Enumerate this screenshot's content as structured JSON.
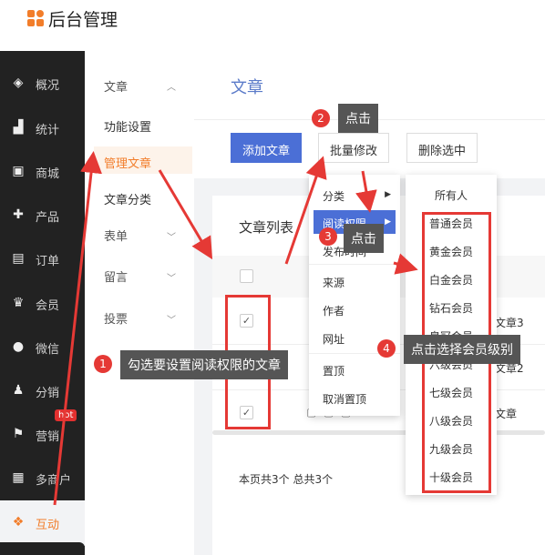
{
  "app": {
    "title": "后台管理",
    "brand_color": "#f27d2a"
  },
  "sidebar": {
    "items": [
      {
        "label": "概况",
        "icon": "layers-icon"
      },
      {
        "label": "统计",
        "icon": "chart-icon"
      },
      {
        "label": "商城",
        "icon": "shop-icon"
      },
      {
        "label": "产品",
        "icon": "grid-icon"
      },
      {
        "label": "订单",
        "icon": "clipboard-icon"
      },
      {
        "label": "会员",
        "icon": "crown-icon"
      },
      {
        "label": "微信",
        "icon": "chat-icon"
      },
      {
        "label": "分销",
        "icon": "users-icon"
      },
      {
        "label": "营销",
        "icon": "flag-icon"
      },
      {
        "label": "多商户",
        "icon": "store-icon"
      },
      {
        "label": "互动",
        "icon": "apps-icon"
      }
    ],
    "hot_badge": "hot"
  },
  "submenu": {
    "group_article": "文章",
    "items": [
      "功能设置",
      "管理文章",
      "文章分类"
    ],
    "groups": [
      "表单",
      "留言",
      "投票"
    ]
  },
  "page": {
    "title": "文章"
  },
  "toolbar": {
    "add": "添加文章",
    "batch": "批量修改",
    "delete": "删除选中"
  },
  "card": {
    "title": "文章列表",
    "row1_text": "文章3",
    "row2_text": "文章2",
    "row3_text": "文章",
    "pager": "本页共3个  总共3个"
  },
  "menu": {
    "items": [
      "分类",
      "阅读权限",
      "发布时间",
      "来源",
      "作者",
      "网址",
      "置顶",
      "取消置顶"
    ]
  },
  "member_levels": [
    "所有人",
    "普通会员",
    "黄金会员",
    "白金会员",
    "钻石会员",
    "皇冠会员",
    "六级会员",
    "七级会员",
    "八级会员",
    "九级会员",
    "十级会员"
  ],
  "annotations": {
    "tip1": "勾选要设置阅读权限的文章",
    "num1": "1",
    "tip2": "点击",
    "num2": "2",
    "tip3": "点击",
    "num3": "3",
    "tip4": "点击选择会员级别",
    "num4": "4"
  }
}
